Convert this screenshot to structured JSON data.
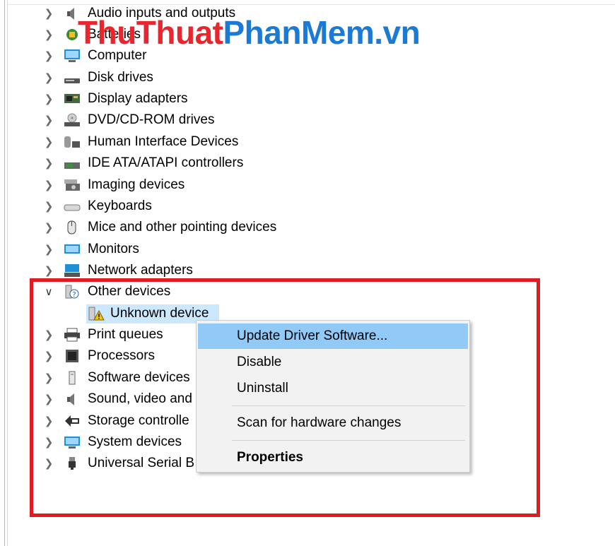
{
  "watermark": {
    "part_red": "ThuThuat",
    "part_blue": "PhanMem.vn"
  },
  "tree": {
    "items": [
      {
        "label": "Audio inputs and outputs",
        "icon": "speaker-icon"
      },
      {
        "label": "Batteries",
        "icon": "battery-icon"
      },
      {
        "label": "Computer",
        "icon": "computer-icon"
      },
      {
        "label": "Disk drives",
        "icon": "disk-drive-icon"
      },
      {
        "label": "Display adapters",
        "icon": "display-adapter-icon"
      },
      {
        "label": "DVD/CD-ROM drives",
        "icon": "dvd-drive-icon"
      },
      {
        "label": "Human Interface Devices",
        "icon": "hid-icon"
      },
      {
        "label": "IDE ATA/ATAPI controllers",
        "icon": "ide-controller-icon"
      },
      {
        "label": "Imaging devices",
        "icon": "imaging-device-icon"
      },
      {
        "label": "Keyboards",
        "icon": "keyboard-icon"
      },
      {
        "label": "Mice and other pointing devices",
        "icon": "mouse-icon"
      },
      {
        "label": "Monitors",
        "icon": "monitor-icon"
      },
      {
        "label": "Network adapters",
        "icon": "network-adapter-icon"
      },
      {
        "label": "Other devices",
        "icon": "unknown-device-category-icon"
      },
      {
        "label": "Unknown device",
        "icon": "warning-device-icon"
      },
      {
        "label": "Print queues",
        "icon": "printer-icon"
      },
      {
        "label": "Processors",
        "icon": "processor-icon"
      },
      {
        "label": "Software devices",
        "icon": "software-device-icon"
      },
      {
        "label": "Sound, video and",
        "icon": "speaker-icon"
      },
      {
        "label": "Storage controlle",
        "icon": "storage-controller-icon"
      },
      {
        "label": "System devices",
        "icon": "system-devices-icon"
      },
      {
        "label": "Universal Serial B",
        "icon": "usb-icon"
      }
    ]
  },
  "context_menu": {
    "update": "Update Driver Software...",
    "disable": "Disable",
    "uninstall": "Uninstall",
    "scan": "Scan for hardware changes",
    "properties": "Properties"
  },
  "colors": {
    "highlight_box": "#e11b22",
    "menu_hover": "#91c9f7",
    "selection": "#cce8ff"
  }
}
